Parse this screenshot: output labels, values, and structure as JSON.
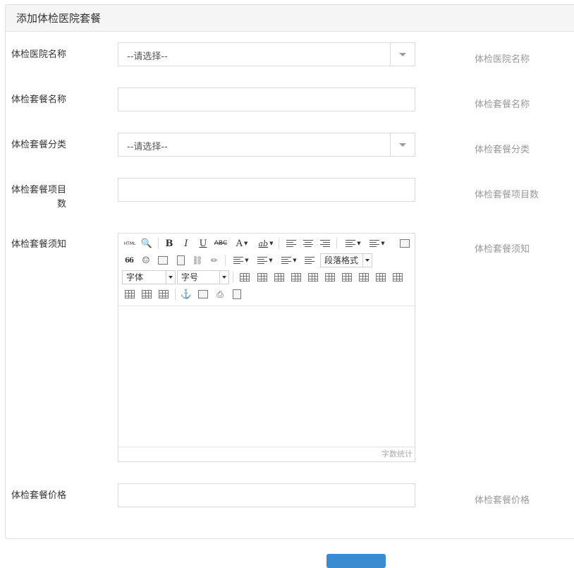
{
  "panel": {
    "title": "添加体检医院套餐"
  },
  "form": {
    "hospital": {
      "label": "体检医院名称",
      "value": "--请选择--",
      "hint": "体检医院名称"
    },
    "package_name": {
      "label": "体检套餐名称",
      "value": "",
      "hint": "体检套餐名称"
    },
    "category": {
      "label": "体检套餐分类",
      "value": "--请选择--",
      "hint": "体检套餐分类"
    },
    "item_count": {
      "label_line1": "体检套餐项目",
      "label_line2": "数",
      "value": "",
      "hint": "体检套餐项目数"
    },
    "notice": {
      "label": "体检套餐须知",
      "hint": "体检套餐须知"
    },
    "price": {
      "label": "体检套餐价格",
      "value": "",
      "hint": "体检套餐价格"
    }
  },
  "editor": {
    "html_label": "HTML",
    "bold": "B",
    "italic": "I",
    "underline": "U",
    "strike": "ABC",
    "font_color": "A",
    "highlight": "ab",
    "quote": "66",
    "paragraph_format": "段落格式",
    "font_family": "字体",
    "font_size": "字号",
    "word_count": "字数统计"
  },
  "submit": {
    "label": ""
  }
}
